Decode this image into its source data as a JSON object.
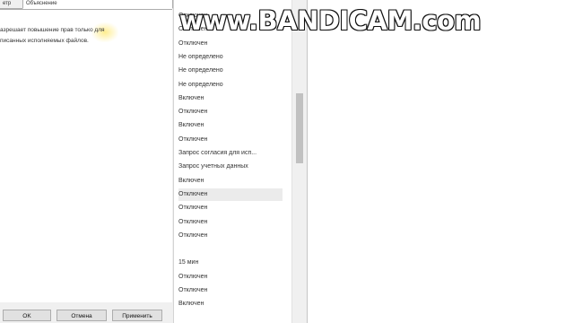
{
  "dialog": {
    "tabs": [
      "етр",
      "Объяснение"
    ],
    "description_lines": [
      "азрешает повышение прав только для",
      "писанных исполняемых файлов."
    ],
    "buttons": {
      "ok": "OK",
      "cancel": "Отмена",
      "apply": "Применить"
    }
  },
  "values": [
    "Отключен",
    "Отключен",
    "Отключен",
    "Не определено",
    "Не определено",
    "Не определено",
    "Включен",
    "Отключен",
    "Включен",
    "Отключен",
    "Запрос согласия для исп...",
    "Запрос учетных данных",
    "Включен",
    "Отключен",
    "Отключен",
    "Отключен",
    "Отключен",
    "",
    "15 мин",
    "Отключен",
    "Отключен",
    "Включен"
  ],
  "selected_value_index": 13,
  "watermark": "www.BANDICAM.com"
}
